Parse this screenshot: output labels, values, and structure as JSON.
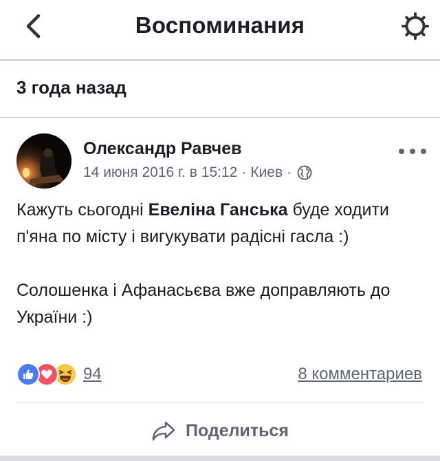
{
  "header": {
    "title": "Воспоминания",
    "back_icon": "chevron-left-icon",
    "settings_icon": "gear-icon"
  },
  "section": {
    "title": "3 года назад"
  },
  "post": {
    "author": "Олександр Равчев",
    "date": "14 июня 2016 г. в 15:12",
    "separator": "·",
    "location": "Киев",
    "privacy_icon": "globe-icon",
    "more_icon": "more-dots-icon",
    "text": {
      "line1_before": "Кажуть сьогодні ",
      "line1_bold": "Евеліна Ганська",
      "line1_after": " буде ходити п'яна по місту і вигукувати радісні гасла :)",
      "paragraph2": "Солошенка і Афанасьєва вже доправляють до України :)"
    },
    "reactions": {
      "icons": [
        "like-icon",
        "love-icon",
        "haha-icon"
      ],
      "count": "94"
    },
    "comments": "8 комментариев",
    "share_label": "Поделиться",
    "share_icon": "share-arrow-icon"
  },
  "colors": {
    "text": "#1c1e21",
    "secondary": "#616770",
    "like": "#4a7bf0",
    "love": "#f25268",
    "haha": "#f7c94a",
    "divider": "#dadde1"
  }
}
